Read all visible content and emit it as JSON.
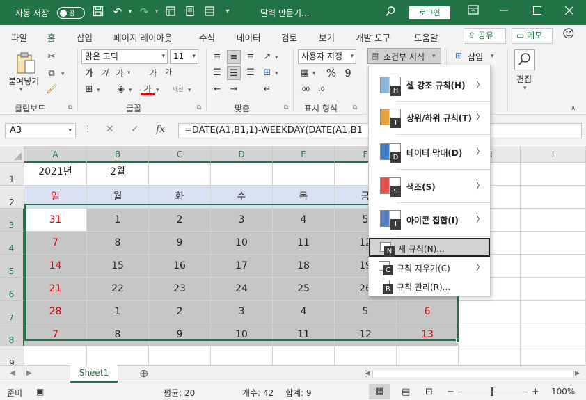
{
  "titlebar": {
    "autosave_label": "자동 저장",
    "autosave_state": "끔",
    "filename": "달력 만들기...",
    "login": "로그인",
    "bg": "#217346"
  },
  "tabs": [
    "파일",
    "홈",
    "삽입",
    "페이지 레이아웃",
    "수식",
    "데이터",
    "검토",
    "보기",
    "개발 도구",
    "도움말"
  ],
  "active_tab": "홈",
  "share_label": "공유",
  "memo_label": "메모",
  "ribbon": {
    "clipboard": {
      "paste": "붙여넣기",
      "label": "클립보드"
    },
    "font": {
      "name": "맑은 고딕",
      "size": "11",
      "label": "글꼴",
      "bold": "가",
      "italic": "가",
      "underline": "가",
      "grow": "가",
      "shrink": "가",
      "phonetic": "내선",
      "fontcolor": "가"
    },
    "align": {
      "label": "맞춤"
    },
    "number": {
      "format": "사용자 지정",
      "label": "표시 형식"
    },
    "styles": {
      "conditional": "조건부 서식"
    },
    "cells": {
      "insert": "삽입"
    },
    "edit": {
      "label": "편집"
    }
  },
  "formula_bar": {
    "namebox": "A3",
    "formula": "=DATE(A1,B1,1)-WEEKDAY(DATE(A1,B1"
  },
  "columns": [
    "A",
    "B",
    "C",
    "D",
    "E",
    "F",
    "G",
    "H",
    "I"
  ],
  "rows": [
    "1",
    "2",
    "3",
    "4",
    "5",
    "6",
    "7",
    "8",
    "9"
  ],
  "sheet": {
    "r1": [
      "2021년",
      "2월"
    ],
    "r2": [
      "일",
      "월",
      "화",
      "수",
      "목",
      "금"
    ],
    "r3": [
      "31",
      "1",
      "2",
      "3",
      "4",
      "5"
    ],
    "r4": [
      "7",
      "8",
      "9",
      "10",
      "11",
      "12"
    ],
    "r5": [
      "14",
      "15",
      "16",
      "17",
      "18",
      "19"
    ],
    "r6": [
      "21",
      "22",
      "23",
      "24",
      "25",
      "26"
    ],
    "r7": [
      "28",
      "1",
      "2",
      "3",
      "4",
      "5",
      "6"
    ],
    "r8": [
      "7",
      "8",
      "9",
      "10",
      "11",
      "12",
      "13"
    ]
  },
  "menu": {
    "items": [
      {
        "label": "셀 강조 규칙(H)",
        "key": "H"
      },
      {
        "label": "상위/하위 규칙(T)",
        "key": "T"
      },
      {
        "label": "데이터 막대(D)",
        "key": "D"
      },
      {
        "label": "색조(S)",
        "key": "S"
      },
      {
        "label": "아이콘 집합(I)",
        "key": "I"
      }
    ],
    "sub": [
      {
        "label": "새 규칙(N)...",
        "key": "N"
      },
      {
        "label": "규칙 지우기(C)",
        "key": "C"
      },
      {
        "label": "규칙 관리(R)...",
        "key": "R"
      }
    ]
  },
  "sheet_tab": "Sheet1",
  "status": {
    "ready": "준비",
    "average": "평균: 20",
    "count": "개수: 42",
    "sum": "합계: 9",
    "zoom": "100%"
  }
}
